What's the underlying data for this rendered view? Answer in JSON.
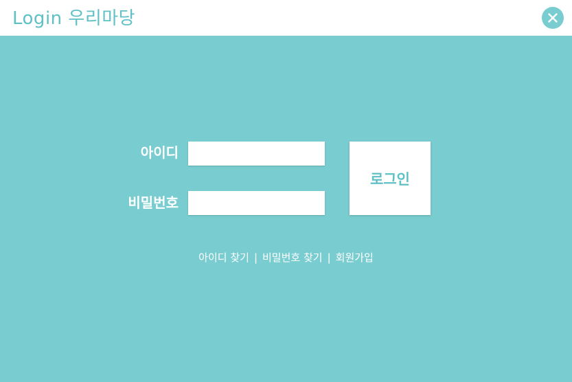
{
  "header": {
    "title": "Login 우리마당",
    "close_icon": "close-icon"
  },
  "form": {
    "id_label": "아이디",
    "id_value": "",
    "pw_label": "비밀번호",
    "pw_value": "",
    "login_label": "로그인"
  },
  "links": {
    "find_id": "아이디 찾기",
    "find_pw": "비밀번호 찾기",
    "signup": "회원가입",
    "separator": "|"
  },
  "colors": {
    "background": "#79cdd0",
    "accent": "#5fc0c6",
    "header": "#ffffff"
  }
}
